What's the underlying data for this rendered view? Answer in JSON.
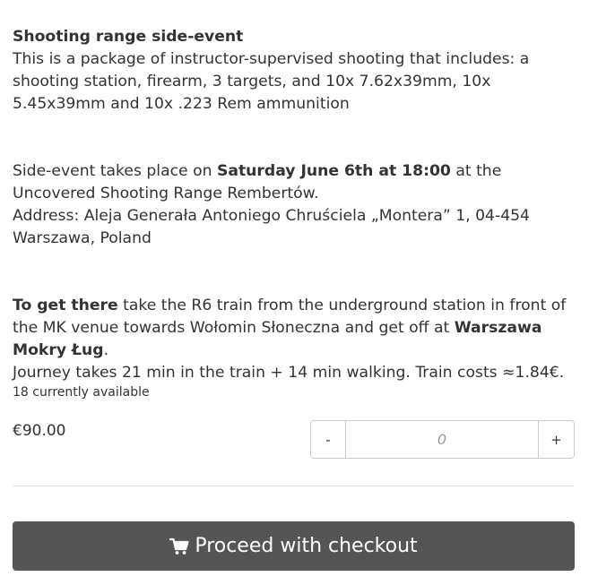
{
  "product": {
    "title": "Shooting range side-event",
    "description": "This is a package of instructor-supervised shooting that includes: a shooting station, firearm, 3 targets, and 10x 7.62x39mm, 10x 5.45x39mm and 10x .223 Rem ammunition",
    "when_prefix": "Side-event takes place on ",
    "when_bold": "Saturday June 6th at 18:00",
    "when_suffix": " at the Uncovered Shooting Range Rembertów.",
    "address": "Address: Aleja Generała Antoniego Chruściela „Montera” 1, 04-454 Warszawa, Poland",
    "directions_bold": "To get there",
    "directions_text": " take the R6 train from the underground station in front of the MK venue towards Wołomin Słoneczna and get off at ",
    "directions_stop": "Warszawa Mokry Ług",
    "directions_end": ".",
    "journey": "Journey takes 21 min in the train + 14 min walking. Train costs ≈1.84€."
  },
  "availability": "18 currently available",
  "price": "€90.00",
  "quantity": {
    "minus_label": "-",
    "plus_label": "+",
    "placeholder": "0"
  },
  "checkout": {
    "label": "Proceed with checkout",
    "icon": "shopping-cart-icon"
  }
}
